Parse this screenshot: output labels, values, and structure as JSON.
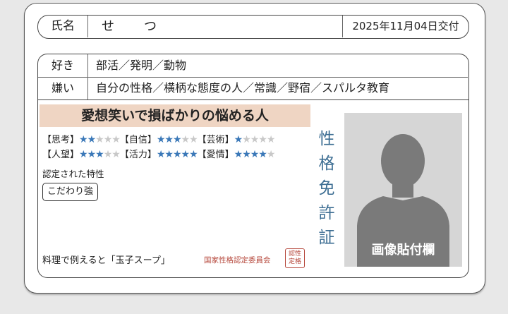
{
  "name_section": {
    "label": "氏名",
    "value": "せ　　つ",
    "date": "2025年11月04日交付"
  },
  "likes": {
    "label": "好き",
    "value": "部活／発明／動物"
  },
  "dislikes": {
    "label": "嫌い",
    "value": "自分の性格／横柄な態度の人／常識／野宿／スパルタ教育"
  },
  "banner": "愛想笑いで損ばかりの悩める人",
  "stats": [
    {
      "label": "【思考】",
      "rating": 2,
      "max": 5
    },
    {
      "label": "【自信】",
      "rating": 3,
      "max": 5
    },
    {
      "label": "【芸術】",
      "rating": 1,
      "max": 5
    },
    {
      "label": "【人望】",
      "rating": 3,
      "max": 5
    },
    {
      "label": "【活力】",
      "rating": 5,
      "max": 5
    },
    {
      "label": "【愛情】",
      "rating": 4,
      "max": 5
    }
  ],
  "traits": {
    "label": "認定された特性",
    "items": [
      "こだわり強"
    ]
  },
  "license_title": [
    "性",
    "格",
    "免",
    "許",
    "証"
  ],
  "photo": {
    "caption": "画像貼付欄"
  },
  "food": "料理で例えると「玉子スープ」",
  "issuer": "国家性格認定委員会",
  "seal": [
    "認性",
    "定格"
  ],
  "colors": {
    "banner_bg": "#efd5c3",
    "star_on": "#3a78b8",
    "star_off": "#c8c8c8",
    "title": "#3d6e93",
    "issuer": "#b5463a"
  }
}
